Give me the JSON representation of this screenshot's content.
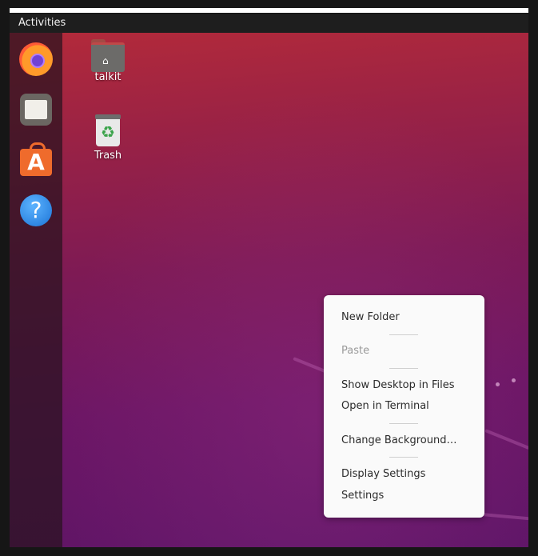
{
  "topbar": {
    "activities_label": "Activities"
  },
  "dock": {
    "items": [
      {
        "name": "Firefox",
        "icon": "firefox-icon"
      },
      {
        "name": "Files",
        "icon": "files-icon"
      },
      {
        "name": "Ubuntu Software",
        "icon": "store-icon",
        "glyph": "A"
      },
      {
        "name": "Help",
        "icon": "help-icon",
        "glyph": "?"
      }
    ]
  },
  "desktop": {
    "icons": [
      {
        "label": "talkit",
        "icon": "home-folder-icon"
      },
      {
        "label": "Trash",
        "icon": "trash-icon"
      }
    ]
  },
  "context_menu": {
    "items": [
      {
        "label": "New Folder",
        "enabled": true
      },
      {
        "label": "Paste",
        "enabled": false
      },
      {
        "label": "Show Desktop in Files",
        "enabled": true
      },
      {
        "label": "Open in Terminal",
        "enabled": true
      },
      {
        "label": "Change Background…",
        "enabled": true
      },
      {
        "label": "Display Settings",
        "enabled": true
      },
      {
        "label": "Settings",
        "enabled": true
      }
    ]
  },
  "colors": {
    "wallpaper_top": "#b32a3a",
    "wallpaper_bottom": "#5e1567",
    "menu_bg": "#fafafa",
    "topbar_bg": "#1e1e1e"
  }
}
